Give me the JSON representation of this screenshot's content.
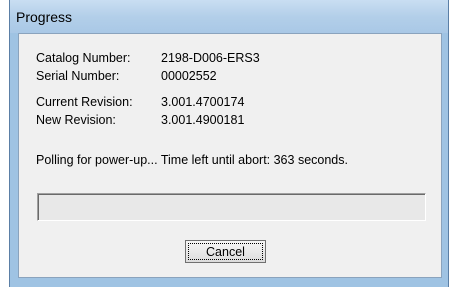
{
  "window": {
    "title": "Progress"
  },
  "device_info": {
    "catalog_number_label": "Catalog Number:",
    "catalog_number_value": "2198-D006-ERS3",
    "serial_number_label": "Serial Number:",
    "serial_number_value": "00002552",
    "current_revision_label": "Current Revision:",
    "current_revision_value": "3.001.4700174",
    "new_revision_label": "New Revision:",
    "new_revision_value": "3.001.4900181"
  },
  "status": {
    "message": "Polling for power-up... Time left until abort: 363 seconds."
  },
  "progress": {
    "percent": 0
  },
  "buttons": {
    "cancel_label": "Cancel"
  },
  "colors": {
    "frame": "#9fc3e3",
    "client_background": "#f0f0f0",
    "progress_fill": "#06b025"
  }
}
